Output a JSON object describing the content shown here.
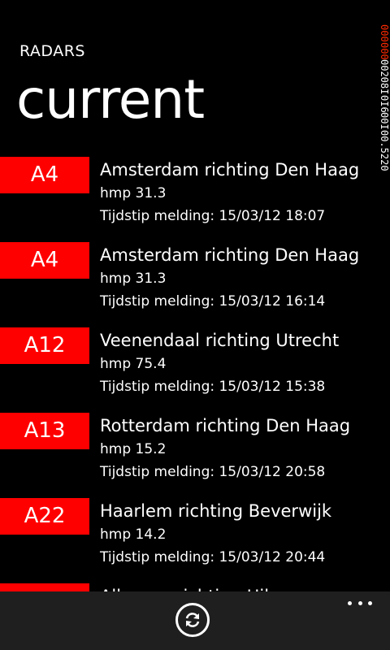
{
  "app_title": "RADARS",
  "page_title": "current",
  "debug_counter": {
    "line1": "000",
    "line2": "000",
    "line3": "00208I",
    "line4": "0I6",
    "line5": "00I",
    "line6": "00.5220"
  },
  "radars": [
    {
      "road": "A4",
      "route": "Amsterdam richting Den Haag",
      "hmp": "hmp 31.3",
      "time": "Tijdstip melding: 15/03/12 18:07"
    },
    {
      "road": "A4",
      "route": "Amsterdam richting Den Haag",
      "hmp": "hmp 31.3",
      "time": "Tijdstip melding: 15/03/12 16:14"
    },
    {
      "road": "A12",
      "route": "Veenendaal richting Utrecht",
      "hmp": "hmp 75.4",
      "time": "Tijdstip melding: 15/03/12 15:38"
    },
    {
      "road": "A13",
      "route": "Rotterdam richting Den Haag",
      "hmp": "hmp 15.2",
      "time": "Tijdstip melding: 15/03/12 20:58"
    },
    {
      "road": "A22",
      "route": "Haarlem richting Beverwijk",
      "hmp": "hmp 14.2",
      "time": "Tijdstip melding: 15/03/12 20:44"
    },
    {
      "road": "",
      "route": "Alkmaar richting Hilversum",
      "hmp": "",
      "time": ""
    }
  ],
  "app_bar": {
    "refresh_icon": "refresh-icon",
    "more_icon": "ellipsis-icon"
  },
  "colors": {
    "accent": "#ff0000",
    "background": "#000000",
    "app_bar": "#1f1f1f"
  }
}
